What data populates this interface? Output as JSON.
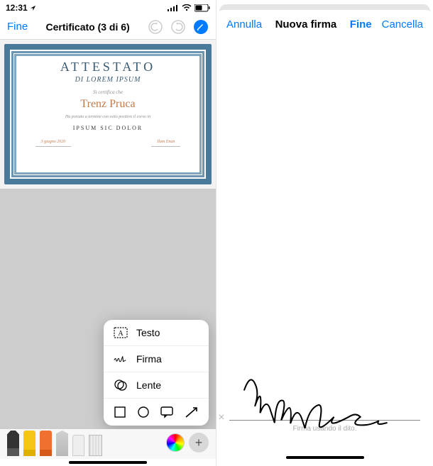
{
  "status": {
    "time": "12:31",
    "signal_icon": "signal-icon",
    "wifi_icon": "wifi-icon",
    "battery_icon": "battery-icon",
    "location_icon": "location-arrow-icon"
  },
  "left": {
    "done_label": "Fine",
    "title": "Certificato (3 di 6)",
    "undo_icon": "undo-icon",
    "redo_icon": "redo-icon",
    "markup_icon": "markup-pen-icon",
    "certificate": {
      "title": "ATTESTATO",
      "subtitle": "DI LOREM IPSUM",
      "certifies": "Si certifica che",
      "name": "Trenz Pruca",
      "body": "Ha portato a termine con esito positivo il corso in",
      "course": "IPSUM SIC DOLOR",
      "date": "3 giugno 2020",
      "signer": "Ilam Enan"
    },
    "popup": {
      "text_label": "Testo",
      "signature_label": "Firma",
      "magnifier_label": "Lente",
      "shapes": {
        "square": "square-shape-icon",
        "circle": "circle-shape-icon",
        "speech": "speech-bubble-icon",
        "arrow": "arrow-shape-icon"
      }
    },
    "toolbar": {
      "pen": "pen-tool-icon",
      "highlighter_yellow": "highlighter-yellow-icon",
      "highlighter_orange": "highlighter-orange-icon",
      "pencil": "pencil-tool-icon",
      "eraser": "eraser-tool-icon",
      "ruler": "ruler-tool-icon",
      "color": "color-picker-icon",
      "plus": "add-shape-icon"
    }
  },
  "right": {
    "cancel_label": "Annulla",
    "title": "Nuova firma",
    "done_label": "Fine",
    "cancel2_label": "Cancella",
    "clear_icon": "clear-x-icon",
    "hint": "Firma usando il dito.",
    "signature_text": "Salvat6re"
  }
}
